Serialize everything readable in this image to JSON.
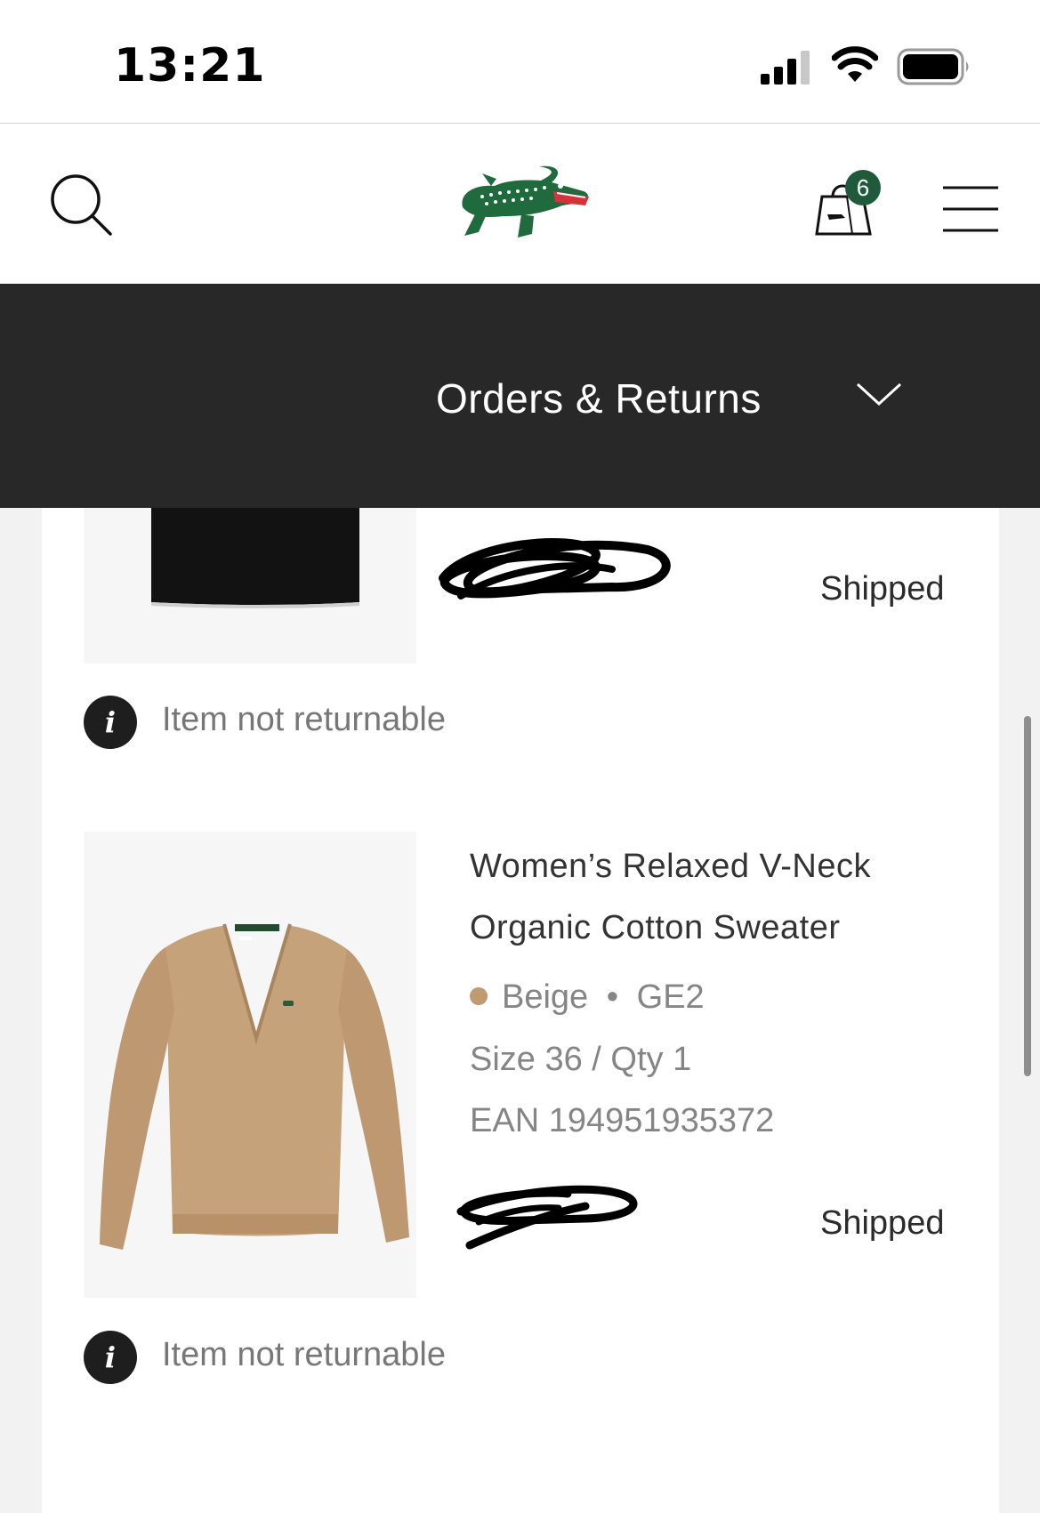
{
  "status_bar": {
    "time": "13:21"
  },
  "header": {
    "cart_count": "6"
  },
  "section": {
    "title": "Orders & Returns"
  },
  "items": [
    {
      "status": "Shipped",
      "notice": "Item not returnable"
    },
    {
      "name_line1": "Women’s Relaxed V-Neck",
      "name_line2": "Organic Cotton Sweater",
      "color": "Beige",
      "separator": "•",
      "color_code": "GE2",
      "size_qty": "Size 36 / Qty 1",
      "ean": "EAN 194951935372",
      "status": "Shipped",
      "notice": "Item not returnable"
    }
  ],
  "colors": {
    "brand_green": "#1f5b3a",
    "dark_bar": "#282829",
    "beige_dot": "#c29a72"
  },
  "icons": [
    "search-icon",
    "lacoste-crocodile-logo",
    "shopping-bag-icon",
    "hamburger-menu-icon",
    "chevron-down-icon",
    "info-icon"
  ]
}
